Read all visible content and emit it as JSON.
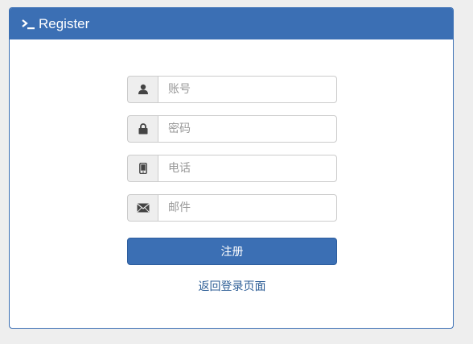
{
  "panel": {
    "title": "Register",
    "title_icon": "terminal-icon"
  },
  "form": {
    "fields": [
      {
        "name": "account",
        "icon": "user-icon",
        "placeholder": "账号",
        "value": ""
      },
      {
        "name": "password",
        "icon": "lock-icon",
        "placeholder": "密码",
        "value": ""
      },
      {
        "name": "phone",
        "icon": "phone-icon",
        "placeholder": "电话",
        "value": ""
      },
      {
        "name": "email",
        "icon": "envelope-icon",
        "placeholder": "邮件",
        "value": ""
      }
    ],
    "submit_label": "注册",
    "back_link_label": "返回登录页面"
  },
  "colors": {
    "primary": "#3b6fb4",
    "link": "#2d5e96",
    "background": "#eeeeee"
  }
}
